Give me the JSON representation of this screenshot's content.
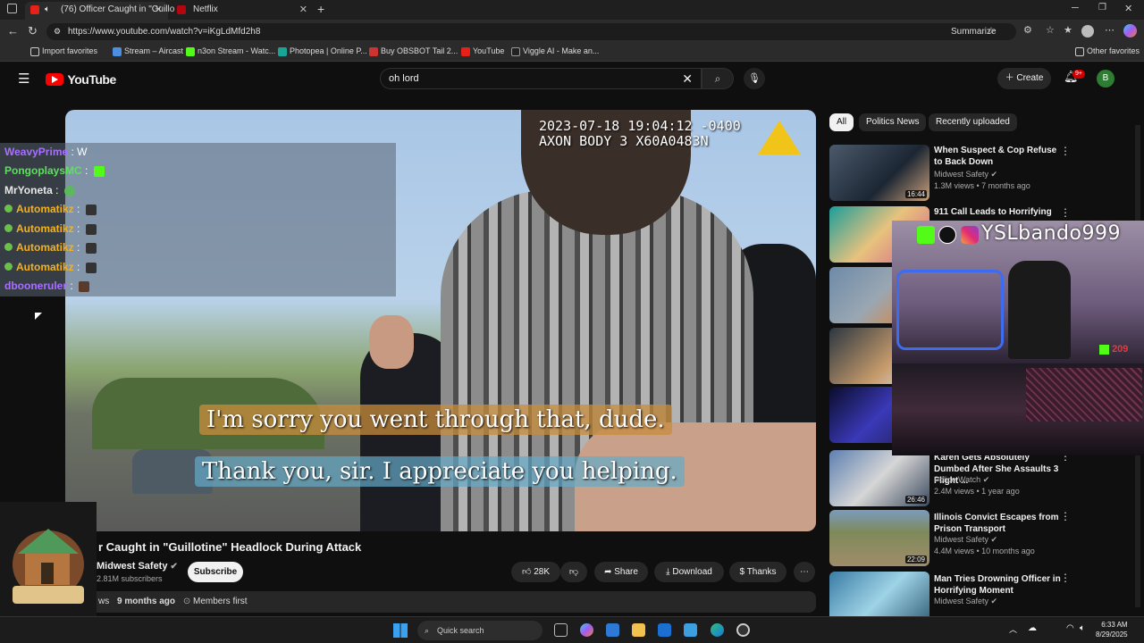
{
  "browser": {
    "tabs": [
      {
        "label": "(76) Officer Caught in \"Guillo",
        "active": true
      },
      {
        "label": "Netflix",
        "active": false
      }
    ],
    "url": "https://www.youtube.com/watch?v=iKgLdMfd2h8",
    "summarize_label": "Summarize",
    "favorites": [
      "Import favorites",
      "Stream – Aircast",
      "n3on Stream - Watc...",
      "Photopea | Online P...",
      "Buy OBSBOT Tail 2...",
      "YouTube",
      "Viggle AI - Make an..."
    ],
    "other_favorites": "Other favorites"
  },
  "youtube": {
    "logo_text": "YouTube",
    "search_value": "oh lord",
    "create_label": "Create",
    "notif_count": "9+",
    "avatar_letter": "B"
  },
  "video": {
    "timestamp_line1": "2023-07-18 19:04:12 -0400",
    "timestamp_line2": "AXON BODY 3 X60A0483N",
    "caption1": "I'm sorry you went through that, dude.",
    "caption2": "Thank you, sir. I appreciate you helping.",
    "title": "r Caught in \"Guillotine\" Headlock During Attack",
    "channel": "Midwest Safety",
    "subscribers": "2.81M subscribers",
    "subscribe_label": "Subscribe",
    "likes": "28K",
    "share_label": "Share",
    "download_label": "Download",
    "thanks_label": "Thanks",
    "meta_views": "ws",
    "meta_age": "9 months ago",
    "meta_members": "Members first"
  },
  "chat": [
    {
      "user": "WeavyPrime",
      "color": "#a970ff",
      "msg": "W",
      "badge": false
    },
    {
      "user": "PongoplaysMC",
      "color": "#5ee05e",
      "msg": "",
      "badge": false
    },
    {
      "user": "MrYoneta",
      "color": "#e8e8e8",
      "msg": "",
      "badge": false
    },
    {
      "user": "Automatikz",
      "color": "#f2b21f",
      "msg": "",
      "badge": true
    },
    {
      "user": "Automatikz",
      "color": "#f2b21f",
      "msg": "",
      "badge": true
    },
    {
      "user": "Automatikz",
      "color": "#f2b21f",
      "msg": "",
      "badge": true
    },
    {
      "user": "Automatikz",
      "color": "#f2b21f",
      "msg": "",
      "badge": true
    },
    {
      "user": "dbooneruler",
      "color": "#a970ff",
      "msg": "",
      "badge": false
    }
  ],
  "sidebar": {
    "chips": [
      "All",
      "Politics News",
      "Recently uploaded"
    ],
    "recs": [
      {
        "title": "When Suspect & Cop Refuse to Back Down",
        "channel": "Midwest Safety",
        "stats": "1.3M views • 7 months ago",
        "duration": "16:44"
      },
      {
        "title": "911 Call Leads to Horrifying",
        "channel": "",
        "stats": "",
        "duration": ""
      },
      {
        "title": "",
        "channel": "",
        "stats": "",
        "duration": ""
      },
      {
        "title": "",
        "channel": "",
        "stats": "",
        "duration": ""
      },
      {
        "title": "",
        "channel": "",
        "stats": "",
        "duration": ""
      },
      {
        "title": "Karen Gets Absolutely Dumbed After She Assaults 3 Flight ...",
        "channel": "Police Watch",
        "stats": "2.4M views • 1 year ago",
        "duration": "26:46"
      },
      {
        "title": "Illinois Convict Escapes from Prison Transport",
        "channel": "Midwest Safety",
        "stats": "4.4M views • 10 months ago",
        "duration": "22:09"
      },
      {
        "title": "Man Tries Drowning Officer in Horrifying Moment",
        "channel": "Midwest Safety",
        "stats": "",
        "duration": ""
      }
    ]
  },
  "webcam": {
    "handle": "YSLbando999",
    "kick_count": "209"
  },
  "logo_overlay": {
    "text": "YSL-BANDO"
  },
  "taskbar": {
    "search_placeholder": "Quick search",
    "time": "6:33 AM",
    "date": "8/29/2025"
  }
}
